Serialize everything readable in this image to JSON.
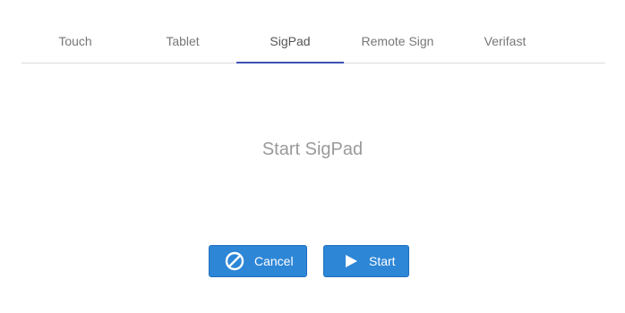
{
  "tabs": [
    {
      "label": "Touch",
      "active": false
    },
    {
      "label": "Tablet",
      "active": false
    },
    {
      "label": "SigPad",
      "active": true
    },
    {
      "label": "Remote Sign",
      "active": false
    },
    {
      "label": "Verifast",
      "active": false
    }
  ],
  "main": {
    "heading": "Start SigPad"
  },
  "buttons": {
    "cancel": {
      "label": "Cancel",
      "icon": "prohibit-icon"
    },
    "start": {
      "label": "Start",
      "icon": "play-icon"
    }
  },
  "colors": {
    "accent": "#3f51b5",
    "button": "#2d86d6",
    "tab_text": "#777777",
    "heading_text": "#9a9a9a"
  }
}
